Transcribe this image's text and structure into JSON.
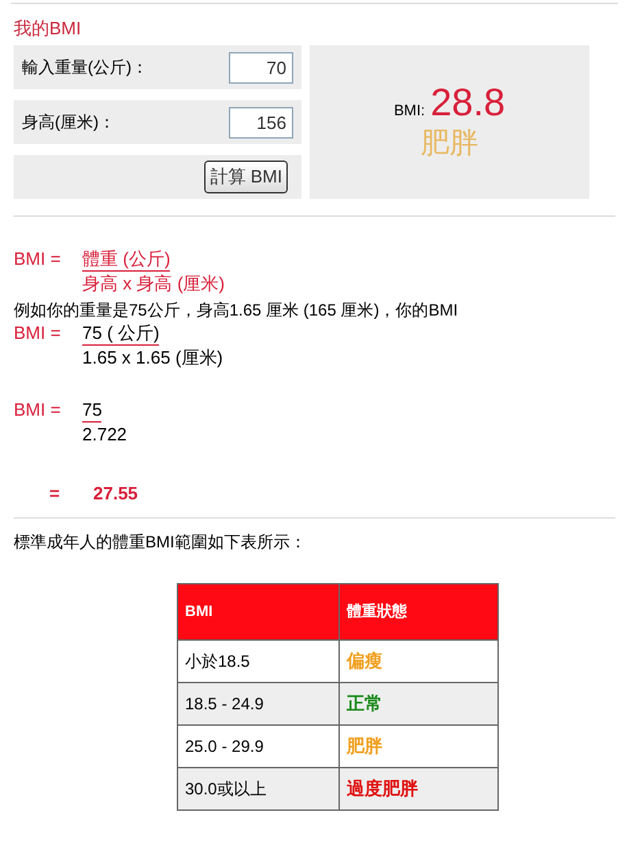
{
  "title": "我的BMI",
  "calculator": {
    "fields": [
      {
        "label": "輸入重量(公斤)：",
        "value": "70"
      },
      {
        "label": "身高(厘米)：",
        "value": "156"
      }
    ],
    "button": "計算 BMI",
    "result": {
      "label": "BMI:",
      "value": "28.8",
      "category": "肥胖"
    }
  },
  "formula": {
    "lhs": "BMI =",
    "numerator": "體重 (公斤)",
    "denominator": "身高 x 身高 (厘米)"
  },
  "example_text": "例如你的重量是75公斤，身高1.65 厘米 (165 厘米)，你的BMI",
  "example_steps": [
    {
      "lhs": "BMI =",
      "numerator": "75 ( 公斤)",
      "denominator": "1.65 x 1.65 (厘米)"
    },
    {
      "lhs": "BMI =",
      "numerator": "75",
      "denominator": "2.722"
    }
  ],
  "example_result": {
    "sign": "=",
    "value": "27.55"
  },
  "table_caption": "標準成年人的體重BMI範圍如下表所示：",
  "table": {
    "columns": [
      "BMI",
      "體重狀態"
    ],
    "rows": [
      {
        "range": "小於18.5",
        "status": "偏瘦",
        "color": "#f0a020"
      },
      {
        "range": "18.5 - 24.9",
        "status": "正常",
        "color": "#1a8a1a"
      },
      {
        "range": "25.0 - 29.9",
        "status": "肥胖",
        "color": "#f0a020"
      },
      {
        "range": "30.0或以上",
        "status": "過度肥胖",
        "color": "#e01010"
      }
    ]
  }
}
